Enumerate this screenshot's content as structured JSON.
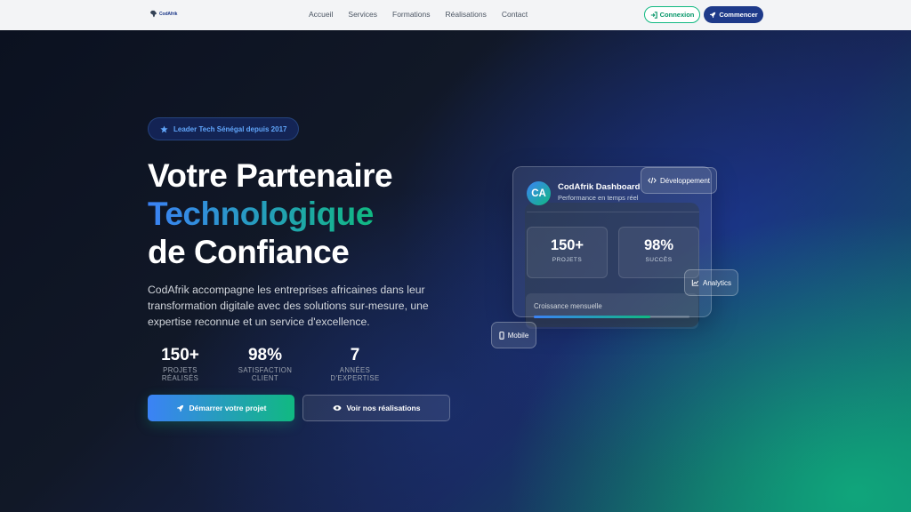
{
  "nav": {
    "logo_text": "CodAfrik",
    "links": [
      "Accueil",
      "Services",
      "Formations",
      "Réalisations",
      "Contact"
    ],
    "login_label": "Connexion",
    "start_label": "Commencer"
  },
  "hero": {
    "badge": "Leader Tech Sénégal depuis 2017",
    "title_line1": "Votre Partenaire",
    "title_line2": "Technologique",
    "title_line3": "de Confiance",
    "description": "CodAfrik accompagne les entreprises africaines dans leur transformation digitale avec des solutions sur-mesure, une expertise reconnue et un service d'excellence.",
    "stats": [
      {
        "value": "150+",
        "label": "PROJETS RÉALISÉS"
      },
      {
        "value": "98%",
        "label": "SATISFACTION CLIENT"
      },
      {
        "value": "7",
        "label": "ANNÉES D'EXPERTISE"
      }
    ],
    "cta_primary": "Démarrer votre projet",
    "cta_secondary": "Voir nos réalisations"
  },
  "dashboard": {
    "avatar": "CA",
    "title": "CodAfrik Dashboard",
    "subtitle": "Performance en temps réel",
    "stats": [
      {
        "value": "150+",
        "label": "PROJETS"
      },
      {
        "value": "98%",
        "label": "SUCCÈS"
      }
    ],
    "growth_label": "Croissance mensuelle",
    "growth_progress": 0.75
  },
  "chips": {
    "development": "Développement",
    "analytics": "Analytics",
    "mobile": "Mobile"
  },
  "colors": {
    "brand_navy": "#1e3a8a",
    "brand_green": "#10b981",
    "brand_blue": "#3b82f6"
  },
  "icons": [
    "africa-logo-icon",
    "login-icon",
    "rocket-icon",
    "star-icon",
    "eye-icon",
    "code-icon",
    "chart-icon",
    "mobile-icon"
  ]
}
